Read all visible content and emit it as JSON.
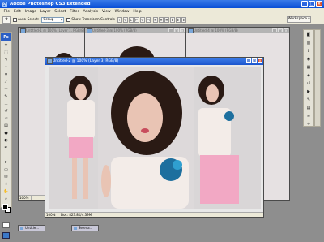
{
  "app": {
    "title": "Adobe Photoshop CS3 Extended",
    "logo_text": "Ps"
  },
  "menu": [
    "File",
    "Edit",
    "Image",
    "Layer",
    "Select",
    "Filter",
    "Analysis",
    "View",
    "Window",
    "Help"
  ],
  "options": {
    "auto_select_label": "Auto-Select:",
    "auto_select_value": "Group",
    "transform_label": "Show Transform Controls",
    "workspace_label": "Workspace ▾"
  },
  "documents": [
    {
      "title": "Untitled-1 @ 100% (Layer 1, RGB/8)"
    },
    {
      "title": "Untitled-3 @ 100% (RGB/8)"
    },
    {
      "title": "Untitled-4 @ 100% (RGB/8)"
    },
    {
      "title": "Untitled-2 @ 100% (Layer 3, RGB/8)",
      "zoom": "100%",
      "doc_info": "Doc: 823.8K/4.39M"
    }
  ],
  "back_doc_zoom": "100%",
  "taskbar": [
    {
      "label": "Untitle..."
    },
    {
      "label": "Selena..."
    }
  ],
  "colors": {
    "title_active": "#0a4fd6",
    "canvas_bg": "#e6e1e2",
    "hair": "#2a1a14",
    "skirt": "#f2a8c4",
    "flower": "#1d6f9e"
  },
  "icons": [
    "move-icon",
    "marquee-icon",
    "lasso-icon",
    "magic-wand-icon",
    "crop-icon",
    "slice-icon",
    "healing-brush-icon",
    "brush-icon",
    "clone-stamp-icon",
    "history-brush-icon",
    "eraser-icon",
    "gradient-icon",
    "blur-icon",
    "dodge-icon",
    "pen-icon",
    "type-icon",
    "path-selection-icon",
    "shape-icon",
    "notes-icon",
    "eyedropper-icon",
    "hand-icon",
    "zoom-icon"
  ]
}
